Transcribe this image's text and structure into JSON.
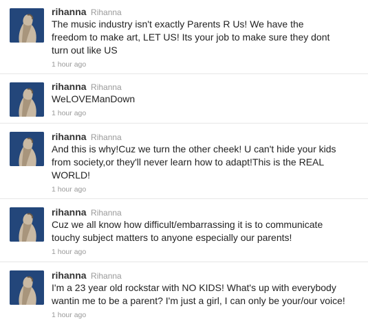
{
  "tweets": [
    {
      "screen_name": "rihanna",
      "full_name": "Rihanna",
      "lines": [
        "The music industry isn't exactly Parents R Us! We have the",
        "freedom to make art, LET US! Its your job to make sure they dont",
        "turn out like US"
      ],
      "time": "1 hour ago"
    },
    {
      "screen_name": "rihanna",
      "full_name": "Rihanna",
      "lines": [
        "WeLOVEManDown"
      ],
      "time": "1 hour ago"
    },
    {
      "screen_name": "rihanna",
      "full_name": "Rihanna",
      "lines": [
        "And this is why!Cuz we turn the other cheek! U can't hide your kids",
        "from society,or they'll never learn how to adapt!This is the REAL",
        "WORLD!"
      ],
      "time": "1 hour ago"
    },
    {
      "screen_name": "rihanna",
      "full_name": "Rihanna",
      "lines": [
        "Cuz we all know how difficult/embarrassing it is to communicate",
        "touchy subject matters to anyone especially our parents!"
      ],
      "time": "1 hour ago"
    },
    {
      "screen_name": "rihanna",
      "full_name": "Rihanna",
      "lines": [
        "I'm a 23 year old rockstar with NO KIDS! What's up with everybody",
        "wantin me to be a parent? I'm just a girl, I can only be your/our voice!"
      ],
      "time": "1 hour ago"
    }
  ]
}
